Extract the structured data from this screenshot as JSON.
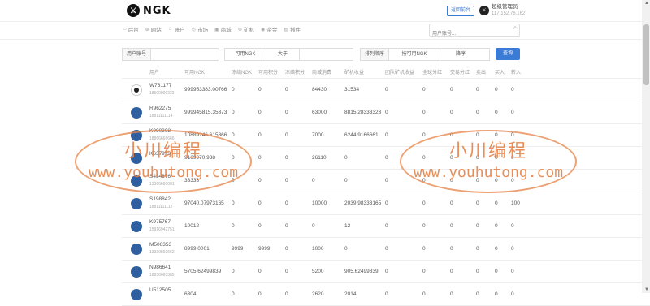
{
  "header": {
    "logo_text": "NGK",
    "logo_mark": "⚔",
    "back_button": "返回前台",
    "admin_name": "超级管理员",
    "admin_ip": "117.152.76.162"
  },
  "nav": [
    {
      "icon": "home-icon",
      "glyph": "⌂",
      "label": "后台"
    },
    {
      "icon": "globe-icon",
      "glyph": "⊕",
      "label": "网站"
    },
    {
      "icon": "user-icon",
      "glyph": "☺",
      "label": "账户"
    },
    {
      "icon": "market-icon",
      "glyph": "◎",
      "label": "市场"
    },
    {
      "icon": "shop-icon",
      "glyph": "▣",
      "label": "商城"
    },
    {
      "icon": "miner-icon",
      "glyph": "⚙",
      "label": "矿机"
    },
    {
      "icon": "fund-icon",
      "glyph": "◉",
      "label": "资金"
    },
    {
      "icon": "plugin-icon",
      "glyph": "▤",
      "label": "插件"
    }
  ],
  "search": {
    "placeholder": "用户账号..."
  },
  "filters": {
    "account_label": "用户账号",
    "field_select": "可用NGK",
    "compare_select": "大于",
    "sort_label": "排列顺序",
    "sort_field": "按可用NGK",
    "sort_order": "降序",
    "query_button": "查询"
  },
  "columns": [
    "用户",
    "可用NGK",
    "冻结NGK",
    "可用积分",
    "冻结积分",
    "商城消费",
    "矿机收益",
    "团队矿机收益",
    "全球分红",
    "交易分红",
    "卖出",
    "买入",
    "转入"
  ],
  "rows": [
    {
      "avatar": "dark",
      "name": "W761177",
      "phone": "18500000333",
      "c": [
        "999953383.00766",
        "0",
        "0",
        "0",
        "84430",
        "31534",
        "0",
        "0",
        "0",
        "0",
        "0",
        "0"
      ]
    },
    {
      "avatar": "blue",
      "name": "R962275",
      "phone": "18811111114",
      "c": [
        "999945815.35373",
        "0",
        "0",
        "0",
        "63000",
        "8815.28333323",
        "0",
        "0",
        "0",
        "0",
        "0",
        "0"
      ]
    },
    {
      "avatar": "blue",
      "name": "K990208",
      "phone": "18866666666",
      "c": [
        "10889246.615366",
        "0",
        "0",
        "0",
        "7000",
        "6244.9166661",
        "0",
        "0",
        "0",
        "0",
        "0",
        "0"
      ]
    },
    {
      "avatar": "blue",
      "name": "K637993",
      "phone": "",
      "c": [
        "9169970.938",
        "0",
        "0",
        "0",
        "26110",
        "0",
        "0",
        "0",
        "0",
        "0",
        "0",
        "0"
      ]
    },
    {
      "avatar": "blue",
      "name": "S454676",
      "phone": "13366660001",
      "c": [
        "33333",
        "0",
        "0",
        "0",
        "0",
        "0",
        "0",
        "0",
        "0",
        "0",
        "0",
        "0"
      ]
    },
    {
      "avatar": "blue",
      "name": "S198842",
      "phone": "18811111112",
      "c": [
        "97040.07973165",
        "0",
        "0",
        "0",
        "10000",
        "2039.98333165",
        "0",
        "0",
        "0",
        "0",
        "0",
        "100"
      ]
    },
    {
      "avatar": "blue",
      "name": "K975767",
      "phone": "15916942751",
      "c": [
        "10012",
        "0",
        "0",
        "0",
        "0",
        "12",
        "0",
        "0",
        "0",
        "0",
        "0",
        "0"
      ]
    },
    {
      "avatar": "blue",
      "name": "M506353",
      "phone": "13330892662",
      "c": [
        "8999.0001",
        "9999",
        "9999",
        "0",
        "1000",
        "0",
        "0",
        "0",
        "0",
        "0",
        "0",
        "0"
      ]
    },
    {
      "avatar": "blue",
      "name": "N986641",
      "phone": "18836663365",
      "c": [
        "5705.62499839",
        "0",
        "0",
        "0",
        "5200",
        "905.62499839",
        "0",
        "0",
        "0",
        "0",
        "0",
        "0"
      ]
    },
    {
      "avatar": "blue",
      "name": "U512505",
      "phone": "",
      "c": [
        "6304",
        "0",
        "0",
        "0",
        "2620",
        "2014",
        "0",
        "0",
        "0",
        "0",
        "0",
        "0"
      ]
    }
  ],
  "watermark": {
    "line1": "小川编程",
    "line2": "www.youhutong.com"
  }
}
